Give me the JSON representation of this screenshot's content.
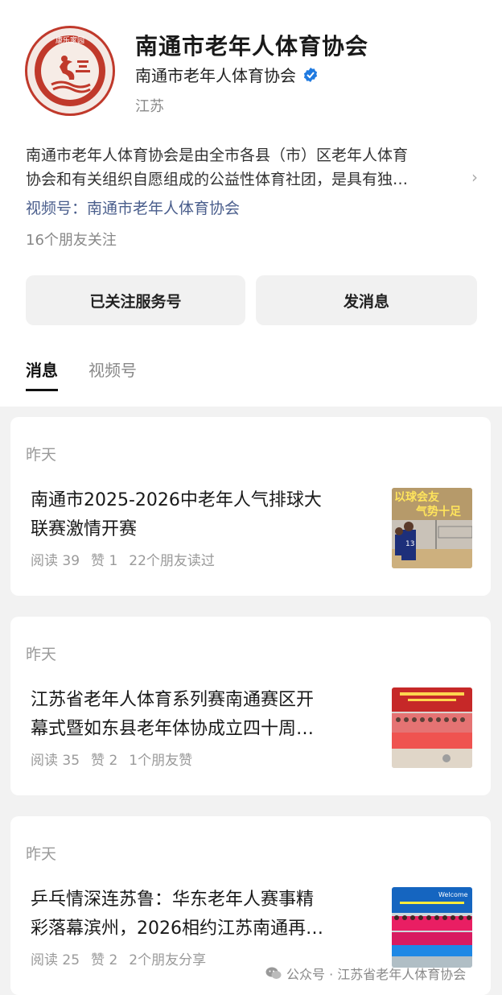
{
  "profile": {
    "logo_text": "康乐家园",
    "logo_ring_text": "南通市老年人体育协会",
    "name": "南通市老年人体育协会",
    "account_name": "南通市老年人体育协会",
    "region": "江苏",
    "description_line1": "南通市老年人体育协会是由全市各县（市）区老年人体育",
    "description_line2": "协会和有关组织自愿组成的公益性体育社团，是具有独…",
    "video_channel": "视频号：南通市老年人体育协会",
    "friends_following": "16个朋友关注"
  },
  "actions": {
    "follow_label": "已关注服务号",
    "message_label": "发消息"
  },
  "tabs": [
    {
      "label": "消息",
      "active": true
    },
    {
      "label": "视频号",
      "active": false
    }
  ],
  "articles": [
    {
      "date": "昨天",
      "title_line1": "南通市2025-2026中老年人气排球大",
      "title_line2": "联赛激情开赛",
      "reads": "阅读 39",
      "likes": "赞 1",
      "social": "22个朋友读过",
      "thumb_text_line1": "以球会友",
      "thumb_text_line2": "气势十足"
    },
    {
      "date": "昨天",
      "title_line1": "江苏省老年人体育系列赛南通赛区开",
      "title_line2": "幕式暨如东县老年体协成立四十周…",
      "reads": "阅读 35",
      "likes": "赞 2",
      "social": "1个朋友赞"
    },
    {
      "date": "昨天",
      "title_line1": "乒乓情深连苏鲁：华东老年人赛事精",
      "title_line2": "彩落幕滨州，2026相约江苏南通再…",
      "reads": "阅读 25",
      "likes": "赞 2",
      "social": "2个朋友分享",
      "thumb_banner": "Welcome"
    }
  ],
  "watermark": "公众号 · 江苏省老年人体育协会",
  "colors": {
    "brand_red": "#c0392b",
    "verified_blue": "#1f7ae0",
    "link_blue": "#4a5e8c"
  }
}
